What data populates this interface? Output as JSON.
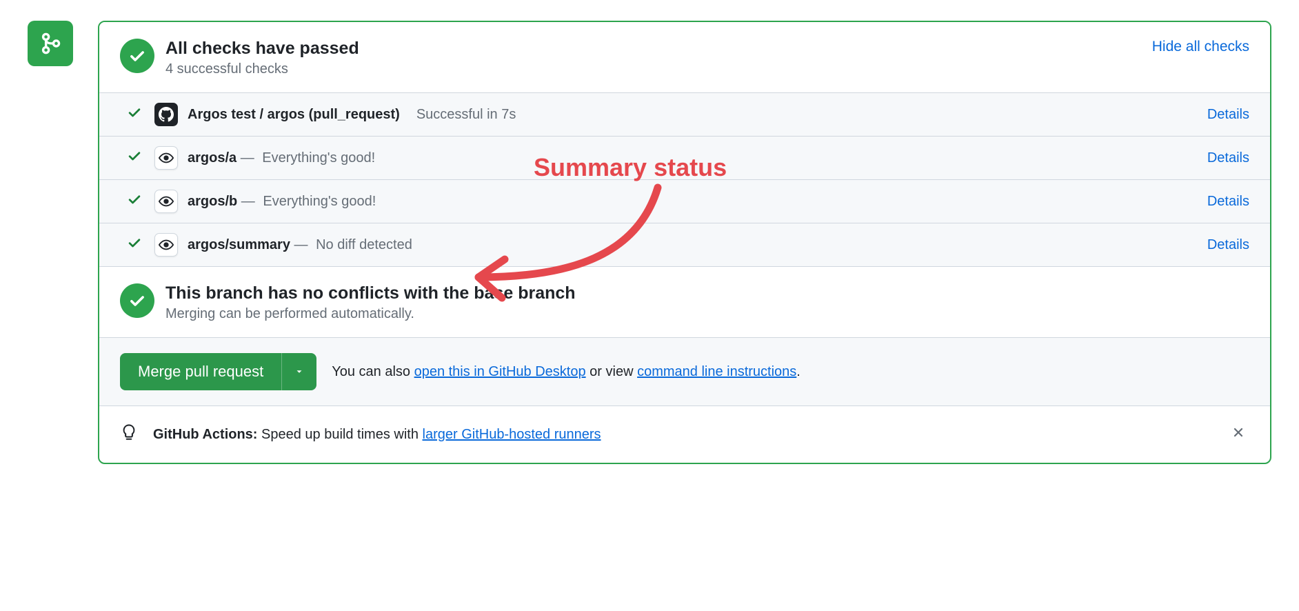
{
  "header": {
    "title": "All checks have passed",
    "subtitle": "4 successful checks",
    "hide_link": "Hide all checks"
  },
  "checks": [
    {
      "icon": "github",
      "name": "Argos test / argos (pull_request)",
      "status": "Successful in 7s",
      "status_inline": true,
      "details": "Details"
    },
    {
      "icon": "eye",
      "name": "argos/a",
      "status": "Everything's good!",
      "details": "Details"
    },
    {
      "icon": "eye",
      "name": "argos/b",
      "status": "Everything's good!",
      "details": "Details"
    },
    {
      "icon": "eye",
      "name": "argos/summary",
      "status": "No diff detected",
      "details": "Details"
    }
  ],
  "conflicts": {
    "title": "This branch has no conflicts with the base branch",
    "subtitle": "Merging can be performed automatically."
  },
  "merge": {
    "button": "Merge pull request",
    "text_prefix": "You can also ",
    "link1": "open this in GitHub Desktop",
    "text_mid": " or view ",
    "link2": "command line instructions",
    "text_suffix": "."
  },
  "tip": {
    "label": "GitHub Actions:",
    "text": " Speed up build times with ",
    "link": "larger GitHub-hosted runners"
  },
  "annotation": {
    "label": "Summary status"
  }
}
